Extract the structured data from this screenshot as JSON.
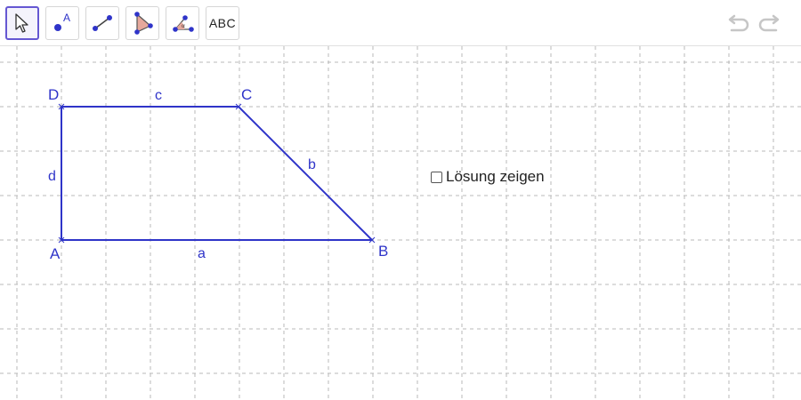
{
  "toolbar": {
    "tools": [
      {
        "name": "move-tool",
        "selected": true,
        "icon": "cursor-arrow-icon"
      },
      {
        "name": "point-tool",
        "selected": false,
        "icon": "point-icon",
        "glyph_label": "A"
      },
      {
        "name": "segment-tool",
        "selected": false,
        "icon": "segment-icon"
      },
      {
        "name": "polygon-tool",
        "selected": false,
        "icon": "polygon-icon"
      },
      {
        "name": "angle-tool",
        "selected": false,
        "icon": "angle-icon",
        "glyph_label": "α"
      },
      {
        "name": "text-tool",
        "selected": false,
        "icon": "text-icon",
        "label": "ABC"
      }
    ],
    "undo_icon": "undo-icon",
    "redo_icon": "redo-icon"
  },
  "colors": {
    "object": "#2f34c9",
    "grid": "#b8b8b8",
    "selected_tool_border": "#6557d2",
    "history_disabled": "#c6c6c6"
  },
  "construction": {
    "points": {
      "A": "A",
      "B": "B",
      "C": "C",
      "D": "D"
    },
    "segments": {
      "a": "a",
      "b": "b",
      "c": "c",
      "d": "d"
    }
  },
  "checkbox": {
    "label": "Lösung zeigen",
    "checked": false
  }
}
